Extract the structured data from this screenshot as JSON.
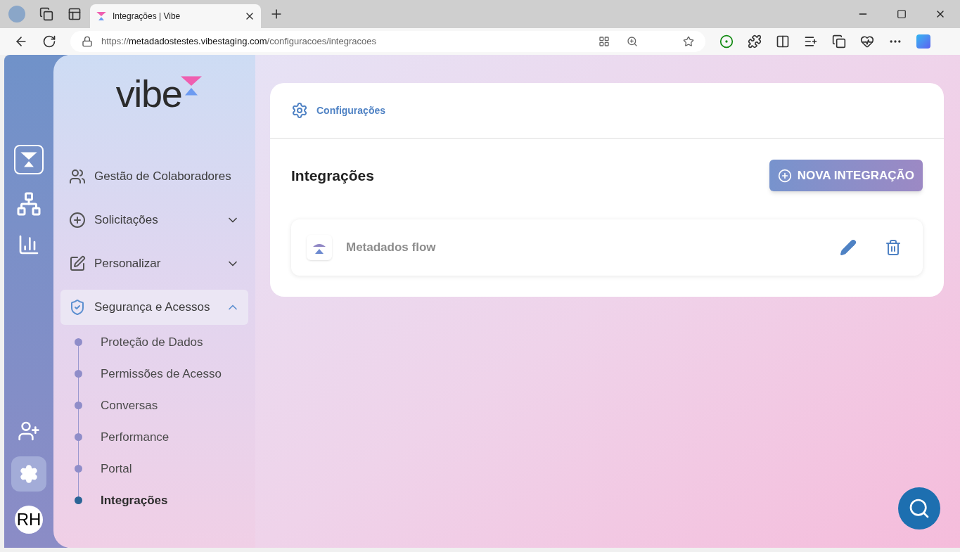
{
  "browser": {
    "tab_title": "Integrações | Vibe",
    "url_scheme": "https://",
    "url_host": "metadadostestes.vibestaging.com",
    "url_path": "/configuracoes/integracoes"
  },
  "rail": {
    "avatar": "RH"
  },
  "sidebar": {
    "logo": "vibe",
    "items": [
      {
        "kind": "link",
        "label": "Gestão de Colaboradores"
      },
      {
        "kind": "group",
        "label": "Solicitações",
        "expanded": false
      },
      {
        "kind": "group",
        "label": "Personalizar",
        "expanded": false
      },
      {
        "kind": "group",
        "label": "Segurança e Acessos",
        "expanded": true,
        "children": [
          {
            "label": "Proteção de Dados",
            "selected": false
          },
          {
            "label": "Permissões de Acesso",
            "selected": false
          },
          {
            "label": "Conversas",
            "selected": false
          },
          {
            "label": "Performance",
            "selected": false
          },
          {
            "label": "Portal",
            "selected": false
          },
          {
            "label": "Integrações",
            "selected": true
          }
        ]
      }
    ]
  },
  "main": {
    "breadcrumb": "Configurações",
    "title": "Integrações",
    "add_button": "NOVA INTEGRAÇÃO",
    "integrations": [
      {
        "name": "Metadados flow"
      }
    ]
  }
}
